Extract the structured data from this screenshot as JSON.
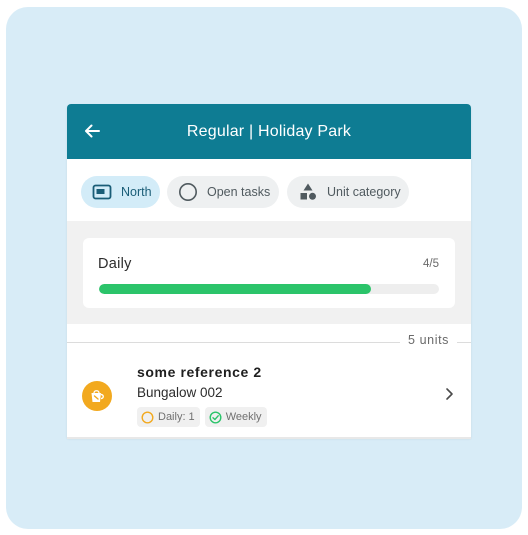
{
  "appbar": {
    "title": "Regular | Holiday Park",
    "back_icon": "arrow-left-icon",
    "color": "#0e7c93"
  },
  "filters": [
    {
      "label": "North",
      "icon": "map-panel-icon",
      "active": true
    },
    {
      "label": "Open tasks",
      "icon": "circle-outline-icon",
      "active": false
    },
    {
      "label": "Unit category",
      "icon": "shapes-icon",
      "active": false
    }
  ],
  "progress": {
    "label": "Daily",
    "count": "4/5",
    "fraction": 0.8,
    "color": "#2bc46a"
  },
  "units": {
    "count_label": "5 units",
    "items": [
      {
        "reference": "some reference 2",
        "name": "Bungalow 002",
        "avatar_icon": "cleaning-bucket-icon",
        "avatar_color": "#f2a91f",
        "badges": [
          {
            "label": "Daily: 1",
            "icon": "circle-outline-icon",
            "color": "#f2a91f"
          },
          {
            "label": "Weekly",
            "icon": "check-circle-icon",
            "color": "#2bc46a"
          }
        ]
      }
    ]
  }
}
